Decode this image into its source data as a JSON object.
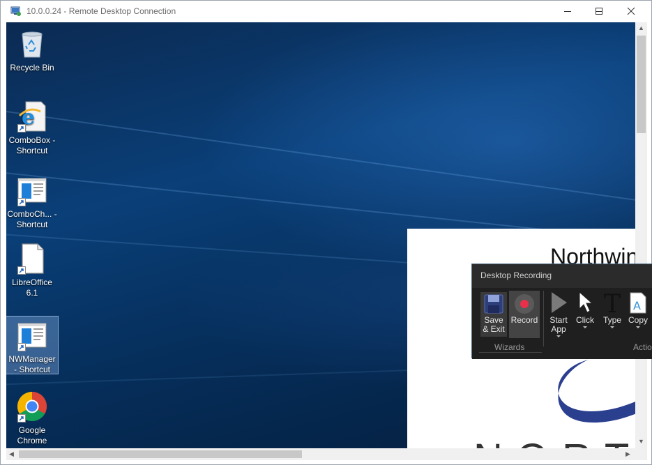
{
  "window": {
    "title": "10.0.0.24 - Remote Desktop Connection",
    "controls": [
      "minimize",
      "maximize",
      "close"
    ]
  },
  "desktop": {
    "icons": [
      {
        "name": "recycle-bin",
        "label": "Recycle Bin",
        "icon": "recycle-bin-icon",
        "selected": false
      },
      {
        "name": "combobox-shortcut",
        "label": "ComboBox - Shortcut",
        "icon": "internet-explorer-icon",
        "selected": false
      },
      {
        "name": "combochart-shortcut",
        "label": "ComboCh... - Shortcut",
        "icon": "app-window-icon",
        "selected": false
      },
      {
        "name": "libreoffice",
        "label": "LibreOffice 6.1",
        "icon": "document-icon",
        "selected": false
      },
      {
        "name": "nwmanager-shortcut",
        "label": "NWManager - Shortcut",
        "icon": "app-window-icon",
        "selected": true
      },
      {
        "name": "google-chrome",
        "label": "Google Chrome",
        "icon": "chrome-icon",
        "selected": false
      }
    ]
  },
  "document": {
    "title": "Northwin",
    "wordmark": "NORT"
  },
  "recording_panel": {
    "title": "Desktop Recording",
    "wizards": {
      "label": "Wizards",
      "save_exit": "Save & Exit",
      "record": "Record"
    },
    "actions": {
      "label": "Actio",
      "start_app": "Start App",
      "click": "Click",
      "type": "Type",
      "copy": "Copy"
    }
  },
  "colors": {
    "accent": "#0078d7",
    "record_dot": "#e8304a",
    "panel_bg": "#2b2b2b"
  }
}
